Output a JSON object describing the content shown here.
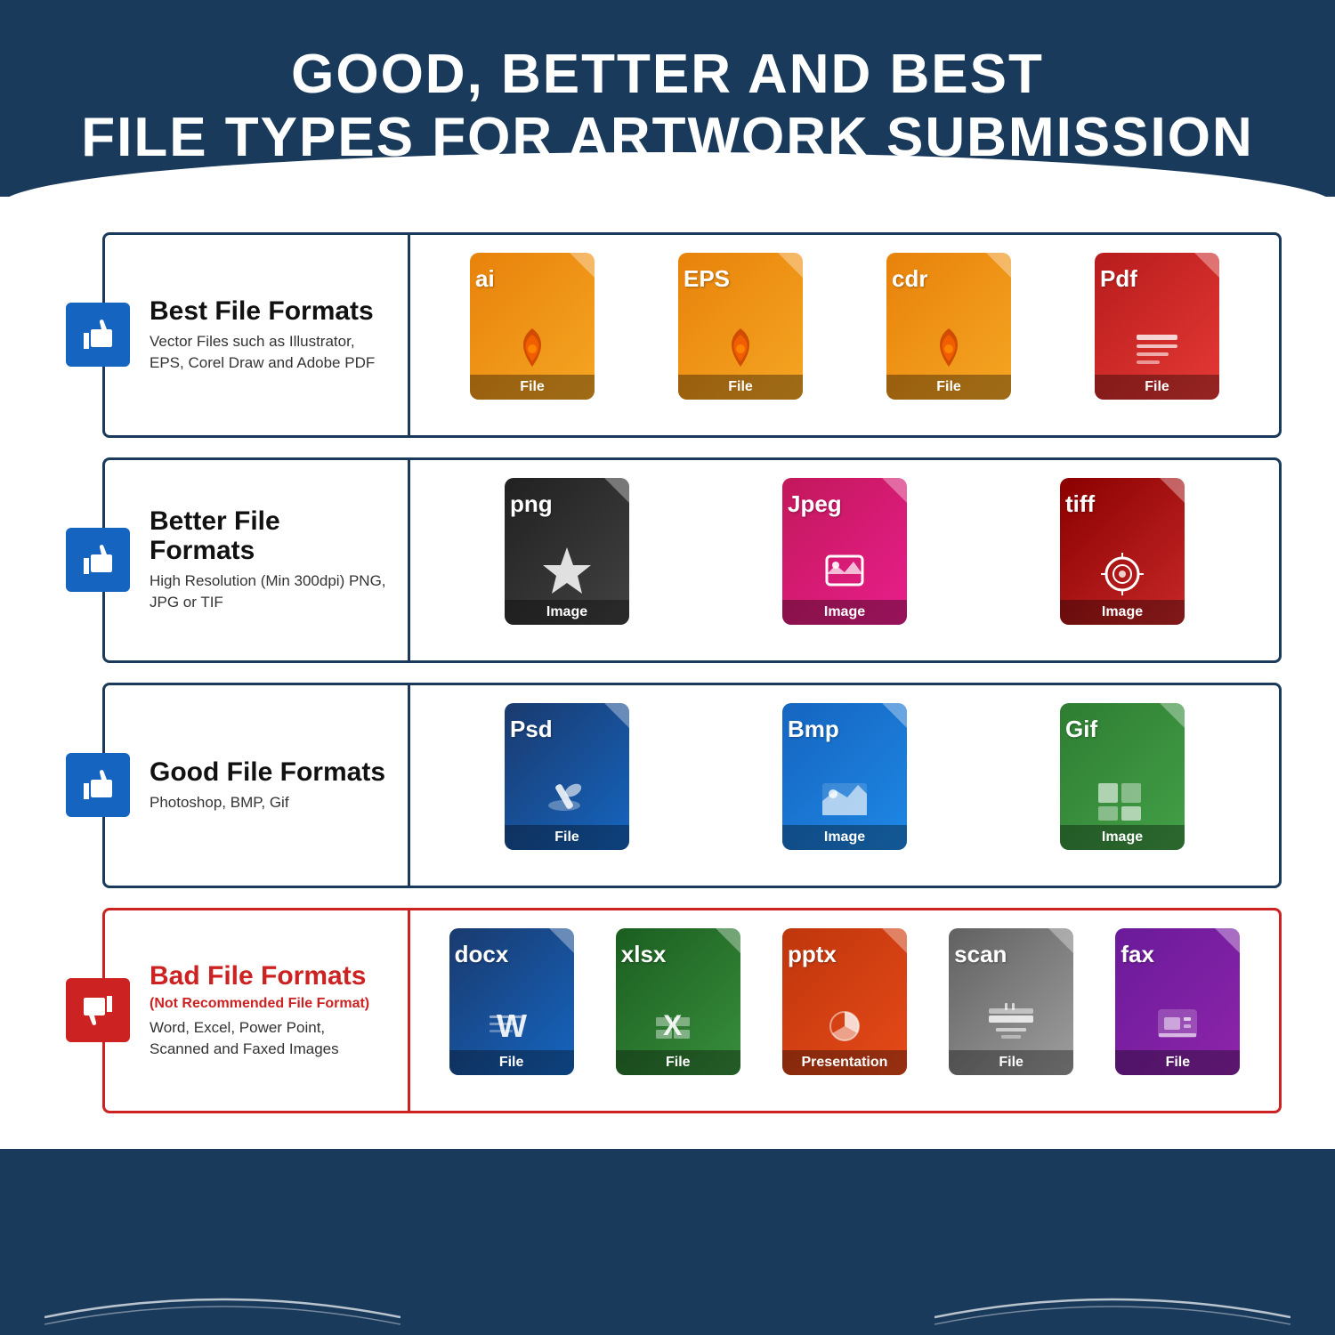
{
  "header": {
    "line1": "GOOD, BETTER AND BEST",
    "line2": "FILE TYPES FOR ARTWORK SUBMISSION"
  },
  "rows": [
    {
      "id": "best",
      "title": "Best File Formats",
      "subtitle": null,
      "desc": "Vector Files such as Illustrator, EPS, Corel Draw and Adobe PDF",
      "thumb": "up",
      "isBad": false,
      "files": [
        {
          "ext": "ai",
          "color": "orange",
          "label": "File",
          "icon": "pen"
        },
        {
          "ext": "EPS",
          "color": "orange",
          "label": "File",
          "icon": "pen"
        },
        {
          "ext": "cdr",
          "color": "orange",
          "label": "File",
          "icon": "pen"
        },
        {
          "ext": "Pdf",
          "color": "red",
          "label": "File",
          "icon": "doc"
        }
      ]
    },
    {
      "id": "better",
      "title": "Better File Formats",
      "subtitle": null,
      "desc": "High Resolution (Min 300dpi) PNG, JPG or TIF",
      "thumb": "up",
      "isBad": false,
      "files": [
        {
          "ext": "png",
          "color": "black",
          "label": "Image",
          "icon": "star"
        },
        {
          "ext": "Jpeg",
          "color": "pink",
          "label": "Image",
          "icon": "camera"
        },
        {
          "ext": "tiff",
          "color": "darkred",
          "label": "Image",
          "icon": "flower"
        }
      ]
    },
    {
      "id": "good",
      "title": "Good File Formats",
      "subtitle": null,
      "desc": "Photoshop, BMP, Gif",
      "thumb": "up",
      "isBad": false,
      "files": [
        {
          "ext": "Psd",
          "color": "navyblue",
          "label": "File",
          "icon": "brush"
        },
        {
          "ext": "Bmp",
          "color": "blue",
          "label": "Image",
          "icon": "landscape"
        },
        {
          "ext": "Gif",
          "color": "green",
          "label": "Image",
          "icon": "grid"
        }
      ]
    },
    {
      "id": "bad",
      "title": "Bad File Formats",
      "subtitle": "(Not Recommended File Format)",
      "desc": "Word, Excel, Power Point, Scanned and Faxed Images",
      "thumb": "down",
      "isBad": true,
      "files": [
        {
          "ext": "docx",
          "color": "msblue",
          "label": "File",
          "icon": "word"
        },
        {
          "ext": "xlsx",
          "color": "msgreen",
          "label": "File",
          "icon": "excel"
        },
        {
          "ext": "pptx",
          "color": "msorange",
          "label": "Presentation",
          "icon": "ppt"
        },
        {
          "ext": "scan",
          "color": "gray",
          "label": "File",
          "icon": "scanner"
        },
        {
          "ext": "fax",
          "color": "purple",
          "label": "File",
          "icon": "fax"
        }
      ]
    }
  ]
}
